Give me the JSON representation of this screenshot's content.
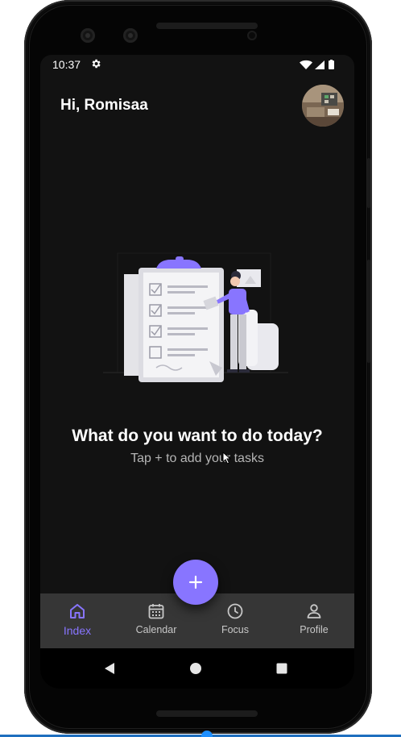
{
  "status_bar": {
    "time": "10:37"
  },
  "header": {
    "greeting": "Hi, Romisaa"
  },
  "empty_state": {
    "title": "What do you want to do today?",
    "subtitle": "Tap + to add your tasks"
  },
  "fab": {
    "icon": "plus-icon"
  },
  "bottom_nav": {
    "items": [
      {
        "label": "Index",
        "icon": "home-icon",
        "active": true
      },
      {
        "label": "Calendar",
        "icon": "calendar-icon",
        "active": false
      },
      {
        "label": "Focus",
        "icon": "clock-icon",
        "active": false
      },
      {
        "label": "Profile",
        "icon": "user-icon",
        "active": false
      }
    ]
  },
  "colors": {
    "accent": "#8875ff",
    "background": "#121212",
    "nav_background": "#363636",
    "text_primary": "#ffffff",
    "text_secondary": "#b5b5b5"
  }
}
